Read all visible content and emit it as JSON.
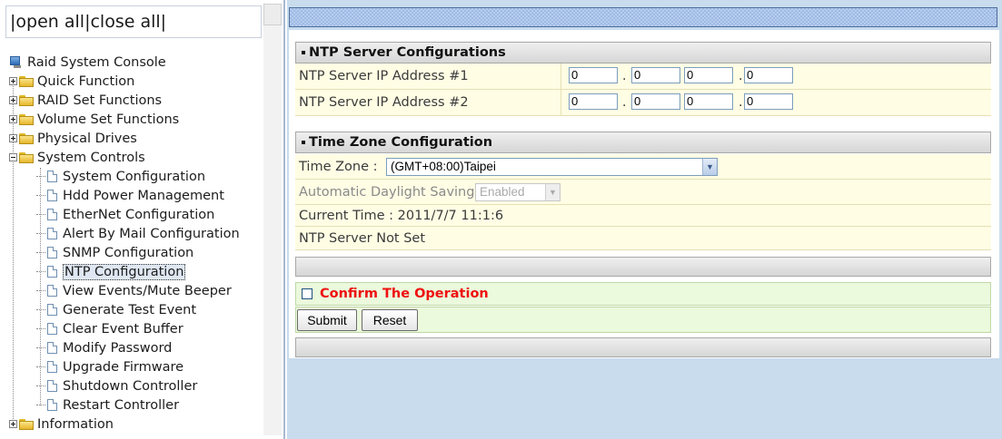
{
  "nav": {
    "open_all": "open all",
    "close_all": "close all",
    "root": "Raid System Console",
    "items": [
      {
        "label": "Quick Function",
        "expanded": false
      },
      {
        "label": "RAID Set Functions",
        "expanded": false
      },
      {
        "label": "Volume Set Functions",
        "expanded": false
      },
      {
        "label": "Physical Drives",
        "expanded": false
      },
      {
        "label": "System Controls",
        "expanded": true
      }
    ],
    "system_controls_children": [
      "System Configuration",
      "Hdd Power Management",
      "EtherNet Configuration",
      "Alert By Mail Configuration",
      "SNMP Configuration",
      "NTP Configuration",
      "View Events/Mute Beeper",
      "Generate Test Event",
      "Clear Event Buffer",
      "Modify Password",
      "Upgrade Firmware",
      "Shutdown Controller",
      "Restart Controller"
    ],
    "selected": "NTP Configuration",
    "last_item": {
      "label": "Information",
      "expanded": false
    }
  },
  "ntp": {
    "section_title": "NTP Server Configurations",
    "server1_label": "NTP Server IP Address #1",
    "server1_octets": [
      "0",
      "0",
      "0",
      "0"
    ],
    "server2_label": "NTP Server IP Address #2",
    "server2_octets": [
      "0",
      "0",
      "0",
      "0"
    ]
  },
  "timezone": {
    "section_title": "Time Zone Configuration",
    "label": "Time Zone :",
    "selected": "(GMT+08:00)Taipei",
    "dst_label": "Automatic Daylight Saving :",
    "dst_value": "Enabled",
    "current_time": "Current Time : 2011/7/7 11:1:6",
    "ntp_status": "NTP Server Not Set"
  },
  "confirm": {
    "label": "Confirm The Operation",
    "checked": false
  },
  "buttons": {
    "submit": "Submit",
    "reset": "Reset"
  },
  "colors": {
    "row_bg": "#fffde4",
    "confirm_bg": "#ebf9dc",
    "confirm_text": "#ee1111",
    "right_frame_bg": "#c8dced"
  }
}
